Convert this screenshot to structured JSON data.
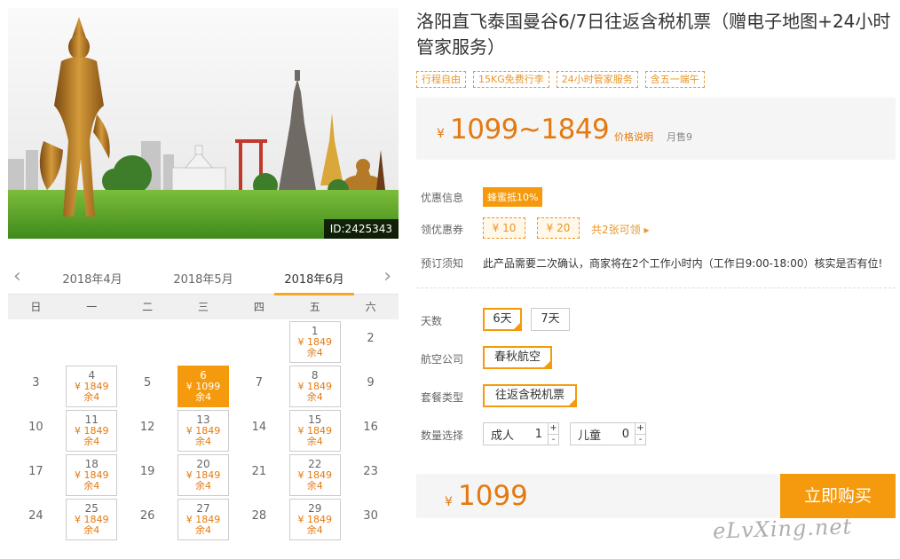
{
  "hero": {
    "image_id": "ID:2425343"
  },
  "calendar": {
    "months": [
      "2018年4月",
      "2018年5月",
      "2018年6月"
    ],
    "weekdays": [
      "日",
      "一",
      "二",
      "三",
      "四",
      "五",
      "六"
    ],
    "cells": [
      {
        "day": "",
        "price": "",
        "stock": ""
      },
      {
        "day": "",
        "price": "",
        "stock": ""
      },
      {
        "day": "",
        "price": "",
        "stock": ""
      },
      {
        "day": "",
        "price": "",
        "stock": ""
      },
      {
        "day": "",
        "price": "",
        "stock": ""
      },
      {
        "day": "1",
        "price": "¥ 1849",
        "stock": "余4"
      },
      {
        "day": "2",
        "price": "",
        "stock": ""
      },
      {
        "day": "3",
        "price": "",
        "stock": ""
      },
      {
        "day": "4",
        "price": "¥ 1849",
        "stock": "余4"
      },
      {
        "day": "5",
        "price": "",
        "stock": ""
      },
      {
        "day": "6",
        "price": "¥ 1099",
        "stock": "余4",
        "selected": true
      },
      {
        "day": "7",
        "price": "",
        "stock": ""
      },
      {
        "day": "8",
        "price": "¥ 1849",
        "stock": "余4"
      },
      {
        "day": "9",
        "price": "",
        "stock": ""
      },
      {
        "day": "10",
        "price": "",
        "stock": ""
      },
      {
        "day": "11",
        "price": "¥ 1849",
        "stock": "余4"
      },
      {
        "day": "12",
        "price": "",
        "stock": ""
      },
      {
        "day": "13",
        "price": "¥ 1849",
        "stock": "余4"
      },
      {
        "day": "14",
        "price": "",
        "stock": ""
      },
      {
        "day": "15",
        "price": "¥ 1849",
        "stock": "余4"
      },
      {
        "day": "16",
        "price": "",
        "stock": ""
      },
      {
        "day": "17",
        "price": "",
        "stock": ""
      },
      {
        "day": "18",
        "price": "¥ 1849",
        "stock": "余4"
      },
      {
        "day": "19",
        "price": "",
        "stock": ""
      },
      {
        "day": "20",
        "price": "¥ 1849",
        "stock": "余4"
      },
      {
        "day": "21",
        "price": "",
        "stock": ""
      },
      {
        "day": "22",
        "price": "¥ 1849",
        "stock": "余4"
      },
      {
        "day": "23",
        "price": "",
        "stock": ""
      },
      {
        "day": "24",
        "price": "",
        "stock": ""
      },
      {
        "day": "25",
        "price": "¥ 1849",
        "stock": "余4"
      },
      {
        "day": "26",
        "price": "",
        "stock": ""
      },
      {
        "day": "27",
        "price": "¥ 1849",
        "stock": "余4"
      },
      {
        "day": "28",
        "price": "",
        "stock": ""
      },
      {
        "day": "29",
        "price": "¥ 1849",
        "stock": "余4"
      },
      {
        "day": "30",
        "price": "",
        "stock": ""
      }
    ]
  },
  "product": {
    "title": "洛阳直飞泰国曼谷6/7日往返含税机票（赠电子地图+24小时管家服务）",
    "tags": [
      "行程自由",
      "15KG免费行李",
      "24小时管家服务",
      "含五一端午"
    ],
    "price_symbol": "¥",
    "price_range": "1099~1849",
    "price_desc": "价格说明",
    "monthly_sales": "月售9"
  },
  "offers": {
    "discount_label": "优惠信息",
    "discount_badge": "蜂蜜抵10%",
    "coupon_label": "领优惠券",
    "coupons": [
      "¥ 10",
      "¥ 20"
    ],
    "coupon_link": "共2张可领 ▸",
    "notice_label": "预订须知",
    "notice_text": "此产品需要二次确认，商家将在2个工作小时内（工作日9:00-18:00）核实是否有位!"
  },
  "options": {
    "days_label": "天数",
    "days": [
      "6天",
      "7天"
    ],
    "airline_label": "航空公司",
    "airline": "春秋航空",
    "package_label": "套餐类型",
    "package": "往返含税机票",
    "qty_label": "数量选择",
    "adult_label": "成人",
    "adult_qty": "1",
    "child_label": "儿童",
    "child_qty": "0",
    "plus": "+",
    "minus": "-"
  },
  "buy": {
    "price_symbol": "¥",
    "price": "1099",
    "button": "立即购买"
  },
  "watermark": "eLvXing.net"
}
